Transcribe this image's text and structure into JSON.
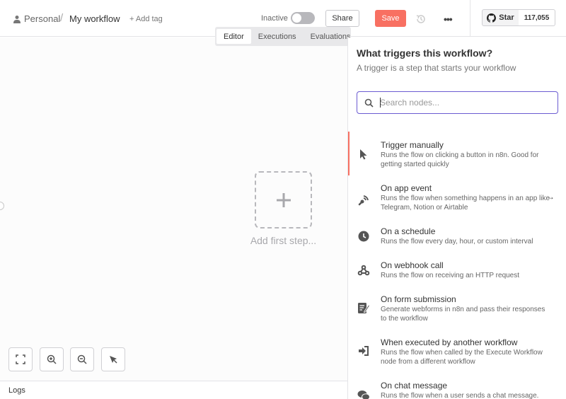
{
  "header": {
    "project": "Personal",
    "separator": "/",
    "workflow_name": "My workflow",
    "add_tag": "+ Add tag",
    "active_label": "Inactive",
    "share": "Share",
    "save": "Save",
    "github_star": "Star",
    "github_count": "117,055"
  },
  "tabs": [
    "Editor",
    "Executions",
    "Evaluations"
  ],
  "canvas": {
    "add_first_step": "Add first step..."
  },
  "logs": {
    "label": "Logs"
  },
  "panel": {
    "title": "What triggers this workflow?",
    "subtitle": "A trigger is a step that starts your workflow",
    "search_placeholder": "Search nodes...",
    "items": [
      {
        "title": "Trigger manually",
        "desc": "Runs the flow on clicking a button in n8n. Good for getting started quickly",
        "icon": "cursor-icon"
      },
      {
        "title": "On app event",
        "desc": "Runs the flow when something happens in an app like Telegram, Notion or Airtable",
        "icon": "app-event-icon"
      },
      {
        "title": "On a schedule",
        "desc": "Runs the flow every day, hour, or custom interval",
        "icon": "clock-icon"
      },
      {
        "title": "On webhook call",
        "desc": "Runs the flow on receiving an HTTP request",
        "icon": "webhook-icon"
      },
      {
        "title": "On form submission",
        "desc": "Generate webforms in n8n and pass their responses to the workflow",
        "icon": "form-icon"
      },
      {
        "title": "When executed by another workflow",
        "desc": "Runs the flow when called by the Execute Workflow node from a different workflow",
        "icon": "sign-in-icon"
      },
      {
        "title": "On chat message",
        "desc": "Runs the flow when a user sends a chat message. For",
        "icon": "chat-icon"
      }
    ]
  },
  "colors": {
    "accent": "#f87062",
    "focus": "#6b5bd2"
  }
}
